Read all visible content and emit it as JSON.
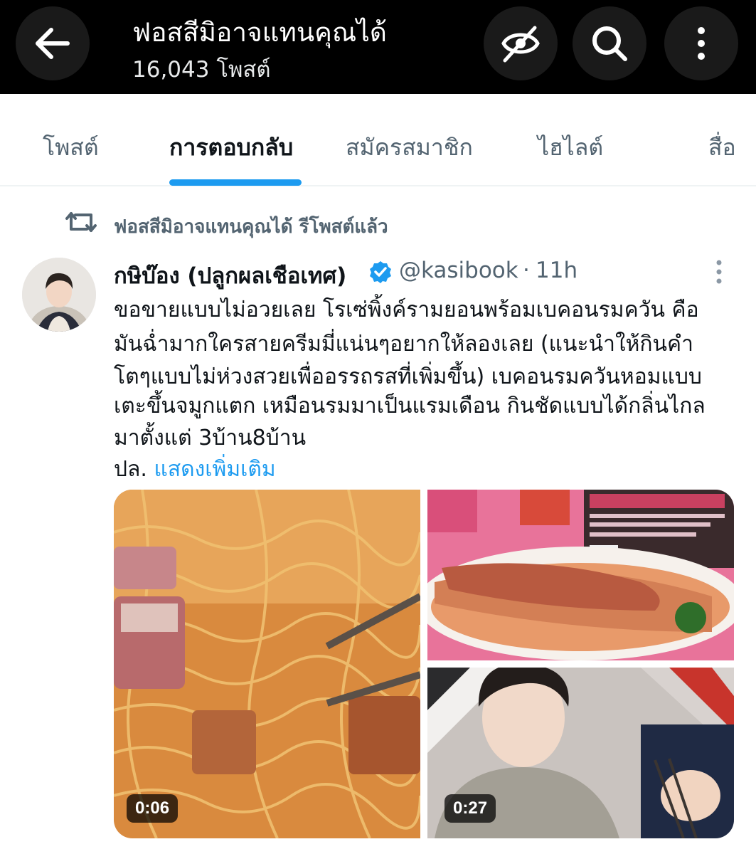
{
  "header": {
    "title": "ฟอสสีมิอาจแทนคุณได้",
    "subtitle": "16,043 โพสต์",
    "back_icon": "arrow-left-icon",
    "hide_icon": "eye-slash-icon",
    "search_icon": "search-icon",
    "more_icon": "more-vertical-icon"
  },
  "tabs": [
    {
      "label": "โพสต์",
      "active": false
    },
    {
      "label": "การตอบกลับ",
      "active": true
    },
    {
      "label": "สมัครสมาชิก",
      "active": false
    },
    {
      "label": "ไฮไลต์",
      "active": false
    },
    {
      "label": "สื่อ",
      "active": false
    }
  ],
  "repost": {
    "text": "ฟอสสีมิอาจแทนคุณได้ รีโพสต์แล้ว",
    "icon": "repost-icon"
  },
  "tweet": {
    "author_name": "กษิบ๊อง (ปลูกผลเชือเทศ)",
    "verified": true,
    "handle": "@kasibook",
    "separator": "·",
    "time": "11h",
    "lines": [
      "ขอขายแบบไม่อวยเลย โรเซ่พิ้งค์รามยอนพร้อมเบคอนรมควัน  คือ",
      "มันฉ่ำมากใครสายครีมมี่แน่นๆอยากให้ลองเลย (แนะนำให้กินคำ",
      "โตๆแบบไม่ห่วงสวยเพื่ออรรถรสที่เพิ่มขึ้น) เบคอนรมควันหอมแบบ",
      "เตะขึ้นจมูกแตก เหมือนรมมาเป็นแรมเดือน กินชัดแบบได้กลิ่นไกล",
      "มาตั้งแต่ 3บ้าน8บ้าน"
    ],
    "last_line_prefix": "ปล.",
    "show_more": "แสดงเพิ่มเติม",
    "media": [
      {
        "kind": "video",
        "duration": "0:06"
      },
      {
        "kind": "image"
      },
      {
        "kind": "video",
        "duration": "0:27"
      }
    ]
  },
  "colors": {
    "accent": "#1d9bf0",
    "header_bg": "#000000",
    "muted_text": "#536471"
  }
}
